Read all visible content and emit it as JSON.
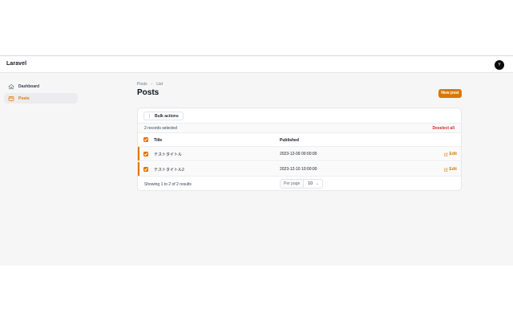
{
  "app": {
    "brand": "Laravel",
    "user_initial": "Y",
    "accent": "#d97706"
  },
  "sidebar": {
    "items": [
      {
        "label": "Dashboard",
        "icon": "home-icon",
        "active": false
      },
      {
        "label": "Posts",
        "icon": "document-icon",
        "active": true
      }
    ]
  },
  "breadcrumb": {
    "items": [
      "Posts",
      "List"
    ],
    "separator": "›"
  },
  "page": {
    "title": "Posts",
    "new_button": "New post"
  },
  "toolbar": {
    "bulk_actions": "Bulk actions"
  },
  "selection": {
    "text": "2 records selected",
    "deselect": "Deselect all"
  },
  "table": {
    "columns": [
      "Title",
      "Published"
    ],
    "rows": [
      {
        "title": "テストタイトル",
        "published": "2023-12-09 00:00:00",
        "action": "Edit"
      },
      {
        "title": "テストタイトル2",
        "published": "2023-12-10 10:00:00",
        "action": "Edit"
      }
    ]
  },
  "pagination": {
    "showing": "Showing 1 to 2 of 2 results",
    "per_page_label": "Per page",
    "per_page_value": "10"
  }
}
